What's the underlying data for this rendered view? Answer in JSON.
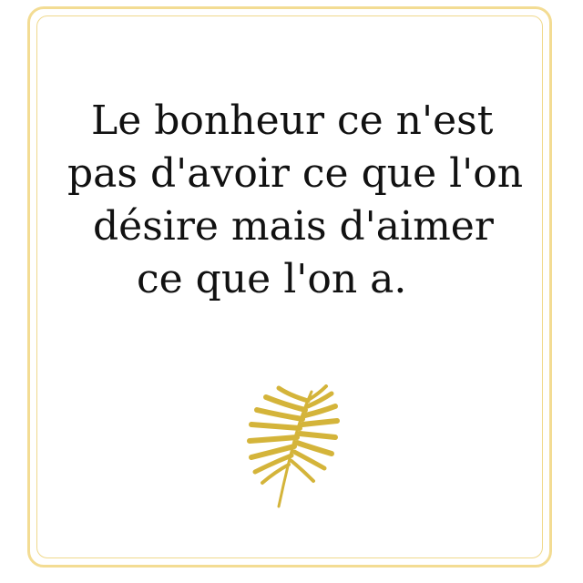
{
  "quote": {
    "lines": [
      "Le bonheur ce n'est",
      "pas d'avoir ce que l'on",
      "désire mais d'aimer",
      "ce que l'on a."
    ]
  },
  "decoration": {
    "icon": "palm-leaf-icon",
    "frame_color": "#f3dc93",
    "leaf_color": "#d4b43a"
  }
}
